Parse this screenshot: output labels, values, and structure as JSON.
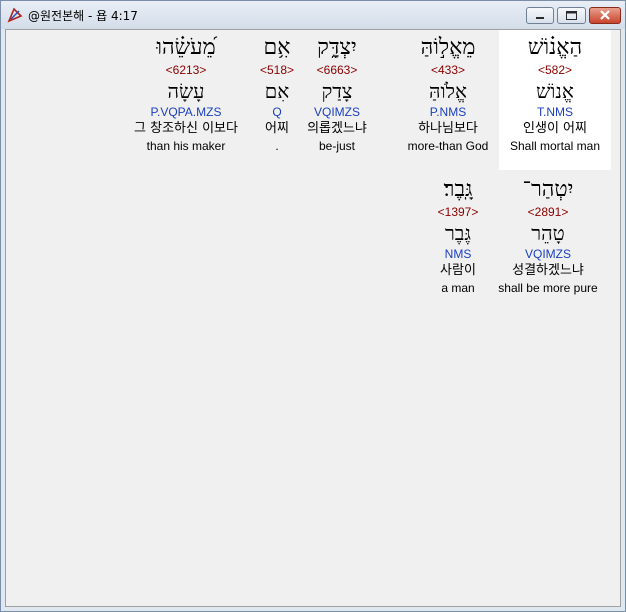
{
  "window": {
    "title": "@원전본해 - 욥 4:17"
  },
  "words": [
    {
      "hebrew": "הַאֱנ֗וֹשׁ",
      "strong": "<582>",
      "lemma": "אֱנוֹשׁ",
      "parsing": "T.NMS",
      "korean": "인생이 어찌",
      "english": "Shall mortal man"
    },
    {
      "hebrew": "מֵאֱל֣וֹהַּ",
      "strong": "<433>",
      "lemma": "אֱלֹוהַּ",
      "parsing": "P.NMS",
      "korean": "하나님보다",
      "english": "more-than God"
    },
    {
      "hebrew": "יִצְדָּ֑ק",
      "strong": "<6663>",
      "lemma": "צָדַק",
      "parsing": "VQIMZS",
      "korean": "의롭겠느냐",
      "english": "be-just"
    },
    {
      "hebrew": "אִ֥ם",
      "strong": "<518>",
      "lemma": "אִם",
      "parsing": "Q",
      "korean": "어찌",
      "english": "."
    },
    {
      "hebrew": "מֵ֝עֹשֵׂ֗הוּ",
      "strong": "<6213>",
      "lemma": "עָשָׂה",
      "parsing": "P.VQPA.MZS",
      "korean": "그 창조하신 이보다",
      "english": "than his maker"
    },
    {
      "hebrew": "יִטְהַר־",
      "strong": "<2891>",
      "lemma": "טָהֵר",
      "parsing": "VQIMZS",
      "korean": "성결하겠느냐",
      "english": "shall be more pure"
    },
    {
      "hebrew": "גָּֽבֶר׃",
      "strong": "<1397>",
      "lemma": "גֶּבֶר",
      "parsing": "NMS",
      "korean": "사람이",
      "english": "a man"
    }
  ]
}
